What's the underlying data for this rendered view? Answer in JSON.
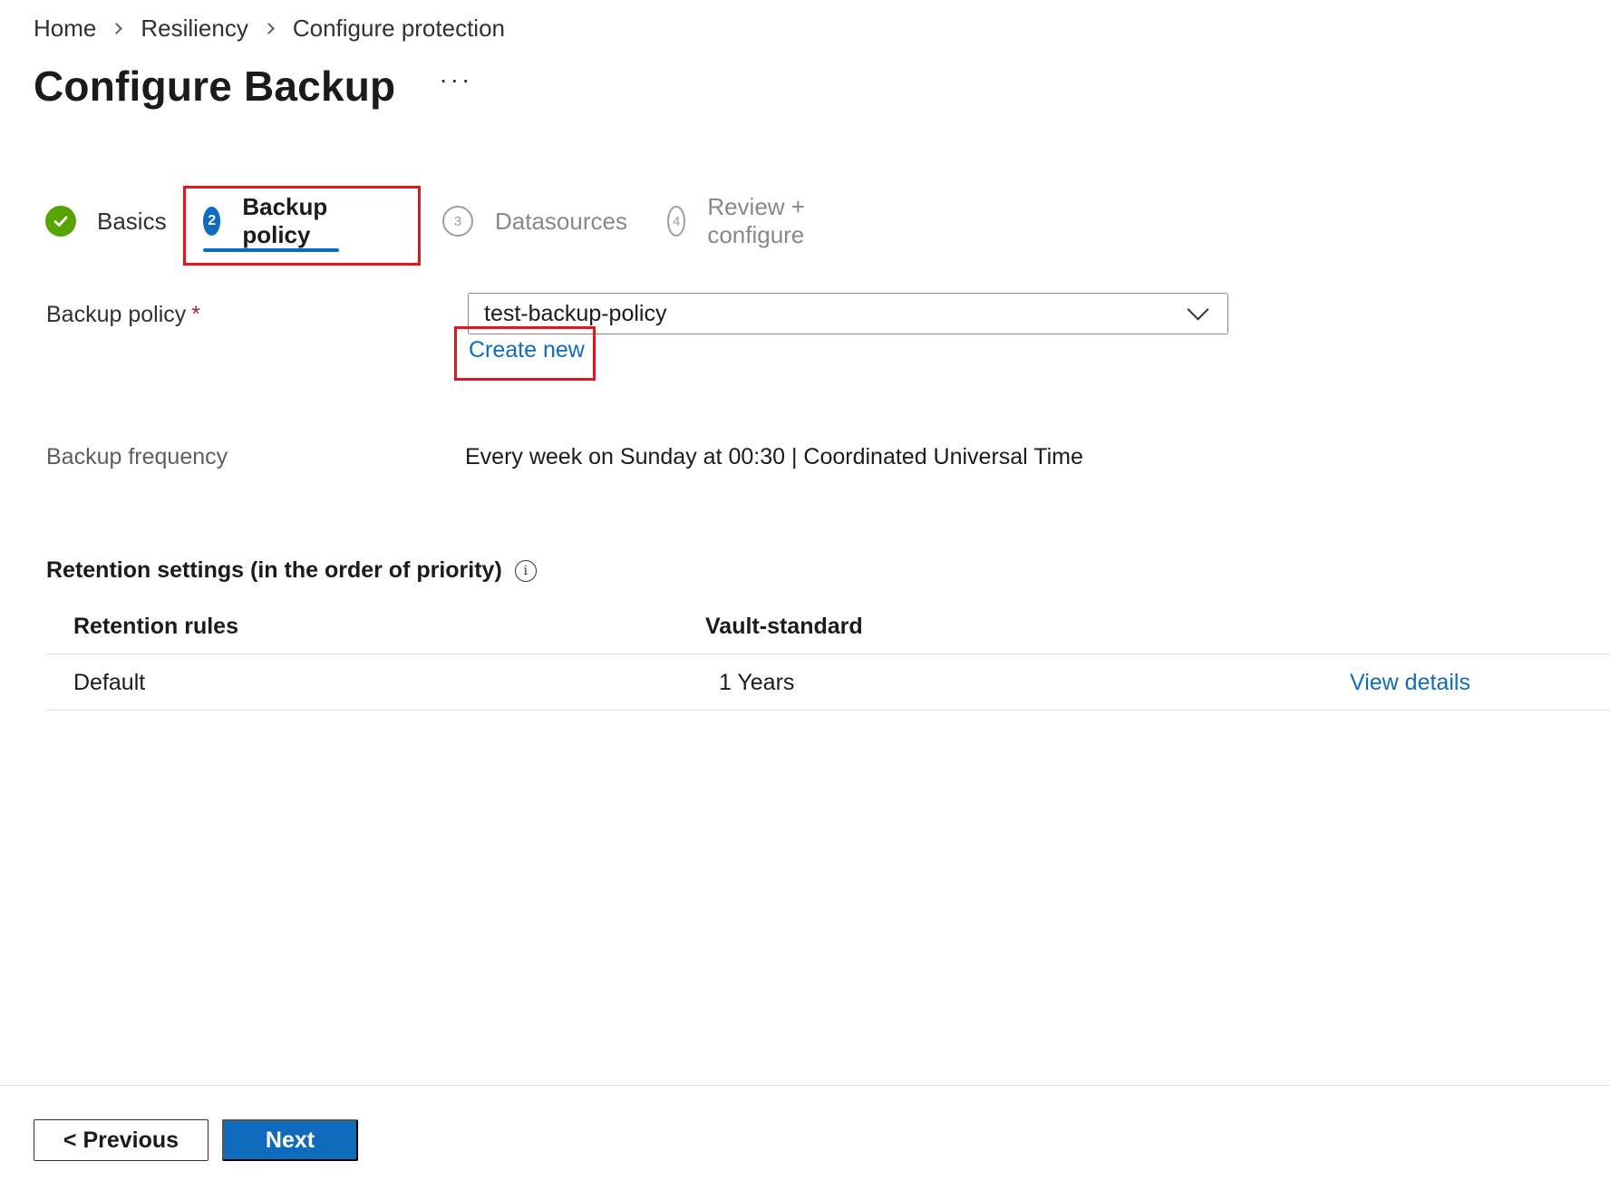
{
  "breadcrumb": [
    "Home",
    "Resiliency",
    "Configure protection"
  ],
  "page": {
    "title": "Configure Backup",
    "more": "···"
  },
  "steps": [
    {
      "number": "1",
      "label": "Basics",
      "state": "completed"
    },
    {
      "number": "2",
      "label": "Backup policy",
      "state": "active"
    },
    {
      "number": "3",
      "label": "Datasources",
      "state": "upcoming"
    },
    {
      "number": "4",
      "label": "Review + configure",
      "state": "upcoming"
    }
  ],
  "form": {
    "policy_label": "Backup policy",
    "required_mark": "*",
    "policy_value": "test-backup-policy",
    "create_new": "Create new",
    "frequency_label": "Backup frequency",
    "frequency_value": "Every week on Sunday at 00:30 | Coordinated Universal Time"
  },
  "retention": {
    "title": "Retention settings (in the order of priority)",
    "info": "i",
    "columns": [
      "Retention rules",
      "Vault-standard"
    ],
    "rows": [
      {
        "rule": "Default",
        "vault_standard": "1 Years",
        "action": "View details"
      }
    ]
  },
  "footer": {
    "previous": "< Previous",
    "next": "Next"
  },
  "colors": {
    "accent": "#0f6cbd",
    "success": "#57a300",
    "highlight": "#e2141c",
    "required": "#a4262c"
  }
}
